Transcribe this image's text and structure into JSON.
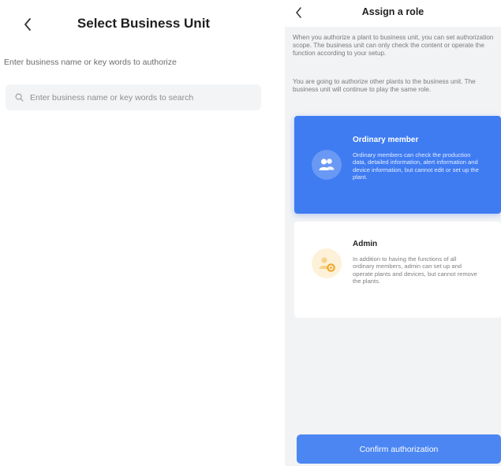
{
  "left": {
    "title": "Select Business Unit",
    "hint": "Enter business name or key words to authorize",
    "search_placeholder": "Enter business name or key words to search"
  },
  "right": {
    "title": "Assign a role",
    "desc1": "When you authorize a plant to business unit, you can set authorization scope. The business unit can only check the content or operate the function according to your setup.",
    "desc2": "You are going to authorize other plants to the business unit. The business unit will continue to play the same role.",
    "roles": [
      {
        "title": "Ordinary member",
        "text": "Ordinary members can check the production data, detailed information, alert information and device information, but cannot edit or set up the plant.",
        "selected": true
      },
      {
        "title": "Admin",
        "text": "In addition to having the functions of all ordinary members, admin can set up and operate plants and devices, but cannot remove the plants.",
        "selected": false
      }
    ],
    "confirm_label": "Confirm authorization"
  },
  "colors": {
    "accent": "#3f7cf2",
    "button": "#4b86f3",
    "admin_icon_bg": "#fdf1d9",
    "admin_icon": "#f2b43a"
  },
  "icons": {
    "back": "chevron-left-icon",
    "search": "search-icon",
    "ordinary": "users-icon",
    "admin": "admin-user-gear-icon"
  }
}
